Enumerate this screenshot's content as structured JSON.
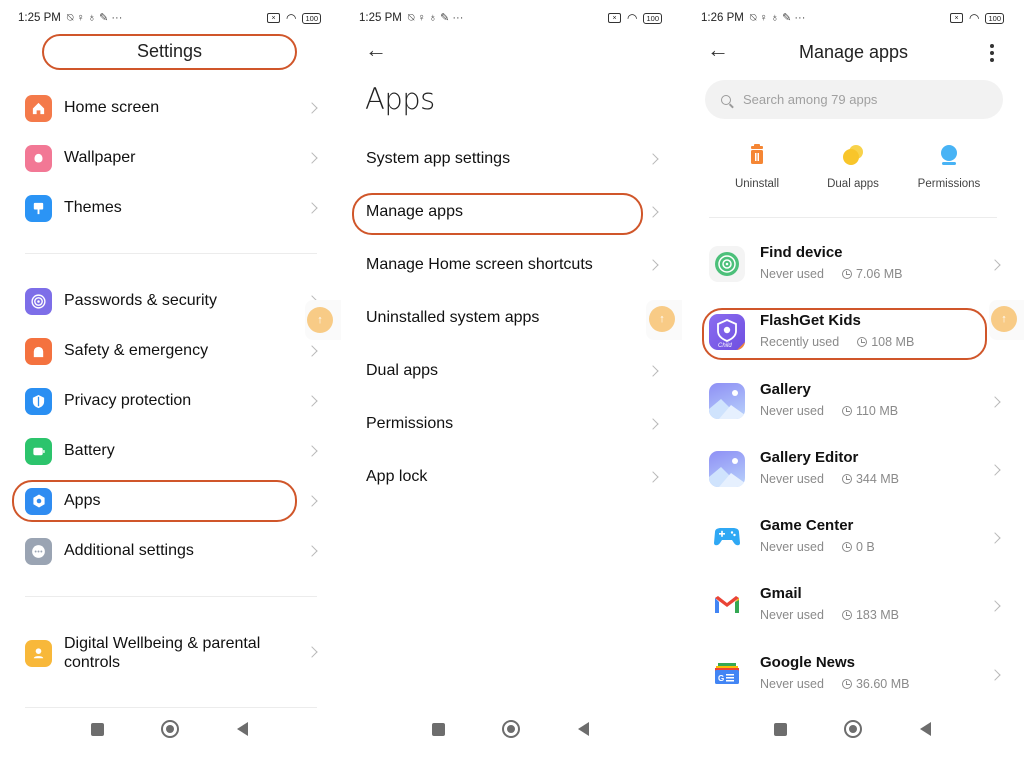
{
  "annotation_color": "#d0562a",
  "panel1": {
    "status": {
      "time": "1:25 PM",
      "battery": "100"
    },
    "title": "Settings",
    "groups": [
      [
        {
          "label": "Home screen",
          "icon": "home-icon",
          "color": "#f47a4a"
        },
        {
          "label": "Wallpaper",
          "icon": "flower-icon",
          "color": "#f27895"
        },
        {
          "label": "Themes",
          "icon": "brush-icon",
          "color": "#2b94f5"
        }
      ],
      [
        {
          "label": "Passwords & security",
          "icon": "fingerprint-icon",
          "color": "#7d6ee8"
        },
        {
          "label": "Safety & emergency",
          "icon": "siren-icon",
          "color": "#f4723f"
        },
        {
          "label": "Privacy protection",
          "icon": "shield-icon",
          "color": "#2a8ff2"
        },
        {
          "label": "Battery",
          "icon": "battery-icon",
          "color": "#2cc46c"
        },
        {
          "label": "Apps",
          "icon": "gear-icon",
          "color": "#2f8cf1"
        },
        {
          "label": "Additional settings",
          "icon": "more-dots-icon",
          "color": "#9aa4b3"
        }
      ],
      [
        {
          "label": "Digital Wellbeing & parental controls",
          "icon": "person-icon",
          "color": "#f8b83a"
        }
      ]
    ]
  },
  "panel2": {
    "status": {
      "time": "1:25 PM",
      "battery": "100"
    },
    "title": "Apps",
    "items": [
      {
        "label": "System app settings"
      },
      {
        "label": "Manage apps"
      },
      {
        "label": "Manage Home screen shortcuts"
      },
      {
        "label": "Uninstalled system apps"
      },
      {
        "label": "Dual apps"
      },
      {
        "label": "Permissions"
      },
      {
        "label": "App lock"
      }
    ]
  },
  "panel3": {
    "status": {
      "time": "1:26 PM",
      "battery": "100"
    },
    "title": "Manage apps",
    "search_placeholder": "Search among 79 apps",
    "quick_actions": [
      {
        "label": "Uninstall",
        "icon": "trash-icon",
        "color": "#f58634"
      },
      {
        "label": "Dual apps",
        "icon": "dual-circles-icon",
        "color": "#f8c52a"
      },
      {
        "label": "Permissions",
        "icon": "permissions-icon",
        "color": "#48b3f5"
      }
    ],
    "apps": [
      {
        "name": "Find device",
        "usage": "Never used",
        "size": "7.06 MB",
        "icon": "find-device-icon"
      },
      {
        "name": "FlashGet Kids",
        "usage": "Recently used",
        "size": "108 MB",
        "icon": "flashget-kids-icon"
      },
      {
        "name": "Gallery",
        "usage": "Never used",
        "size": "110 MB",
        "icon": "gallery-icon"
      },
      {
        "name": "Gallery Editor",
        "usage": "Never used",
        "size": "344 MB",
        "icon": "gallery-editor-icon"
      },
      {
        "name": "Game Center",
        "usage": "Never used",
        "size": "0 B",
        "icon": "gamepad-icon"
      },
      {
        "name": "Gmail",
        "usage": "Never used",
        "size": "183 MB",
        "icon": "gmail-icon"
      },
      {
        "name": "Google News",
        "usage": "Never used",
        "size": "36.60 MB",
        "icon": "google-news-icon"
      }
    ]
  }
}
